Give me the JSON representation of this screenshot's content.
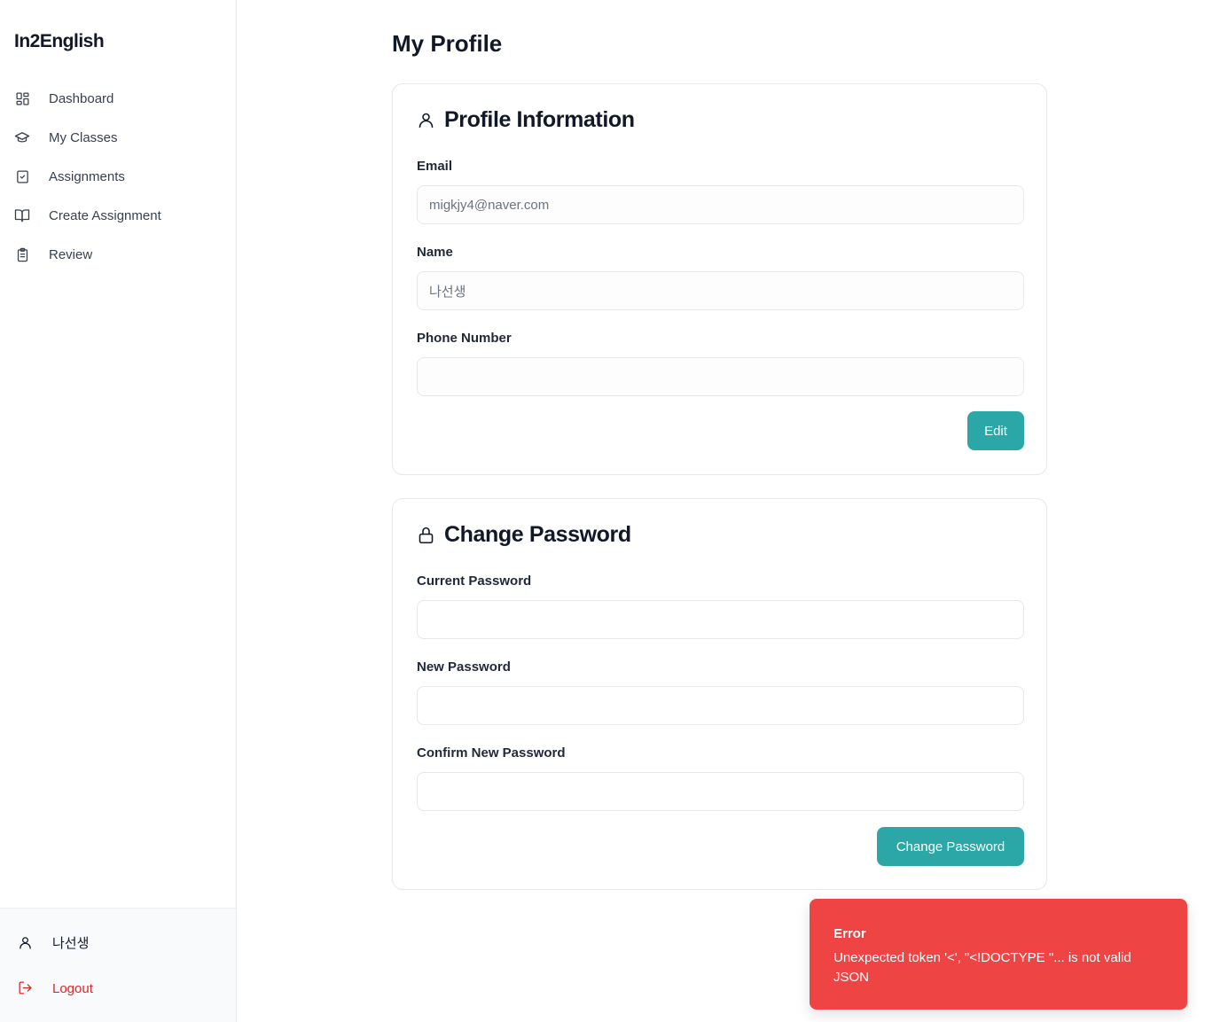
{
  "app": {
    "brand": "In2English"
  },
  "sidebar": {
    "items": [
      {
        "label": "Dashboard",
        "icon": "dashboard-grid-icon"
      },
      {
        "label": "My Classes",
        "icon": "graduation-cap-icon"
      },
      {
        "label": "Assignments",
        "icon": "clipboard-check-icon"
      },
      {
        "label": "Create Assignment",
        "icon": "open-book-icon"
      },
      {
        "label": "Review",
        "icon": "clipboard-list-icon"
      }
    ],
    "user": {
      "name": "나선생",
      "icon": "user-icon"
    },
    "logout": {
      "label": "Logout",
      "icon": "logout-icon"
    }
  },
  "page": {
    "title": "My Profile"
  },
  "profile": {
    "title": "Profile Information",
    "email_label": "Email",
    "email_value": "migkjy4@naver.com",
    "name_label": "Name",
    "name_value": "나선생",
    "phone_label": "Phone Number",
    "phone_value": "",
    "edit_label": "Edit"
  },
  "password": {
    "title": "Change Password",
    "current_label": "Current Password",
    "new_label": "New Password",
    "confirm_label": "Confirm New Password",
    "submit_label": "Change Password"
  },
  "toast": {
    "title": "Error",
    "message": "Unexpected token '<', \"<!DOCTYPE \"... is not valid JSON"
  },
  "colors": {
    "accent": "#2aa7a6",
    "error": "#ef4444",
    "logout": "#dc2626"
  }
}
